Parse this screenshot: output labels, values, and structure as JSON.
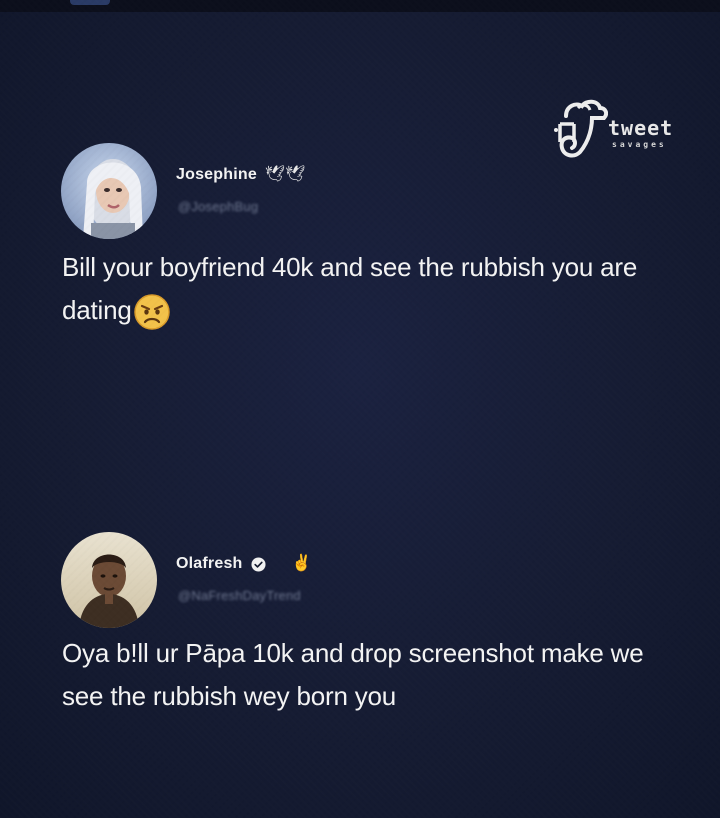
{
  "watermark": {
    "brand": "tweet",
    "tagline": "savages",
    "icon": "tweet-savages-logo-icon"
  },
  "tweets": [
    {
      "display_name": "Josephine",
      "name_emoji": "🕊🕊",
      "handle": "@JosephBug",
      "text": "Bill your boyfriend 40k and see the rubbish you are dating",
      "trailing_emoji": "😠",
      "avatar_icon": "profile-photo-avatar"
    },
    {
      "display_name": "Olafresh",
      "verified": true,
      "name_emoji": "✌",
      "handle": "@NaFreshDayTrend",
      "text": "Oya b!ll ur Pāpa 10k and drop screenshot make we see the rubbish wey born you",
      "avatar_icon": "profile-photo-avatar"
    }
  ],
  "colors": {
    "background": "#161c33",
    "text": "#f4f4f4",
    "handle": "#6e7790"
  }
}
